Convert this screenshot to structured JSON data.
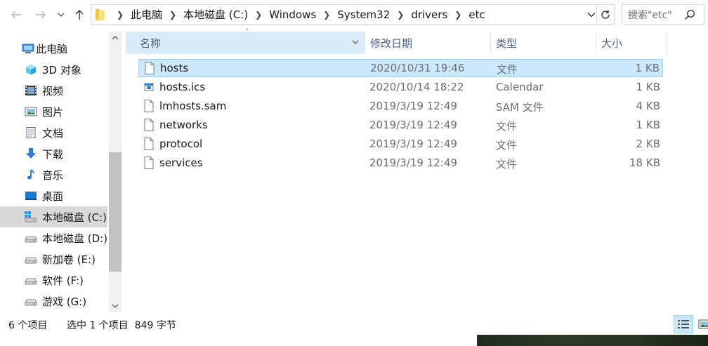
{
  "address": {
    "segments": [
      "此电脑",
      "本地磁盘 (C:)",
      "Windows",
      "System32",
      "drivers",
      "etc"
    ]
  },
  "search": {
    "placeholder": "搜索\"etc\""
  },
  "nav": {
    "items": [
      {
        "label": "此电脑",
        "icon": "computer-icon"
      },
      {
        "label": "3D 对象",
        "icon": "cube-3d-icon"
      },
      {
        "label": "视频",
        "icon": "video-icon"
      },
      {
        "label": "图片",
        "icon": "pictures-icon"
      },
      {
        "label": "文档",
        "icon": "document-icon"
      },
      {
        "label": "下载",
        "icon": "download-icon"
      },
      {
        "label": "音乐",
        "icon": "music-icon"
      },
      {
        "label": "桌面",
        "icon": "desktop-icon"
      },
      {
        "label": "本地磁盘 (C:)",
        "icon": "windows-drive-icon",
        "selected": true
      },
      {
        "label": "本地磁盘 (D:)",
        "icon": "drive-icon"
      },
      {
        "label": "新加卷 (E:)",
        "icon": "drive-icon"
      },
      {
        "label": "软件 (F:)",
        "icon": "drive-icon"
      },
      {
        "label": "游戏 (G:)",
        "icon": "drive-icon"
      }
    ]
  },
  "columns": {
    "name": "名称",
    "date": "修改日期",
    "type": "类型",
    "size": "大小"
  },
  "files": [
    {
      "name": "hosts",
      "date": "2020/10/31 19:46",
      "type": "文件",
      "size": "1 KB",
      "selected": true,
      "icon": "file-icon"
    },
    {
      "name": "hosts.ics",
      "date": "2020/10/14 18:22",
      "type": "Calendar",
      "size": "1 KB",
      "icon": "calendar-file-icon"
    },
    {
      "name": "lmhosts.sam",
      "date": "2019/3/19 12:49",
      "type": "SAM 文件",
      "size": "4 KB",
      "icon": "file-icon"
    },
    {
      "name": "networks",
      "date": "2019/3/19 12:49",
      "type": "文件",
      "size": "1 KB",
      "icon": "file-icon"
    },
    {
      "name": "protocol",
      "date": "2019/3/19 12:49",
      "type": "文件",
      "size": "2 KB",
      "icon": "file-icon"
    },
    {
      "name": "services",
      "date": "2019/3/19 12:49",
      "type": "文件",
      "size": "18 KB",
      "icon": "file-icon"
    }
  ],
  "status": {
    "count": "6 个项目",
    "selection": "选中 1 个项目  849 字节"
  },
  "colors": {
    "selection_bg": "#cce8ff",
    "selection_border": "#99d1ff",
    "header_text": "#4d6082",
    "nav_selected": "#d9d9d9"
  }
}
